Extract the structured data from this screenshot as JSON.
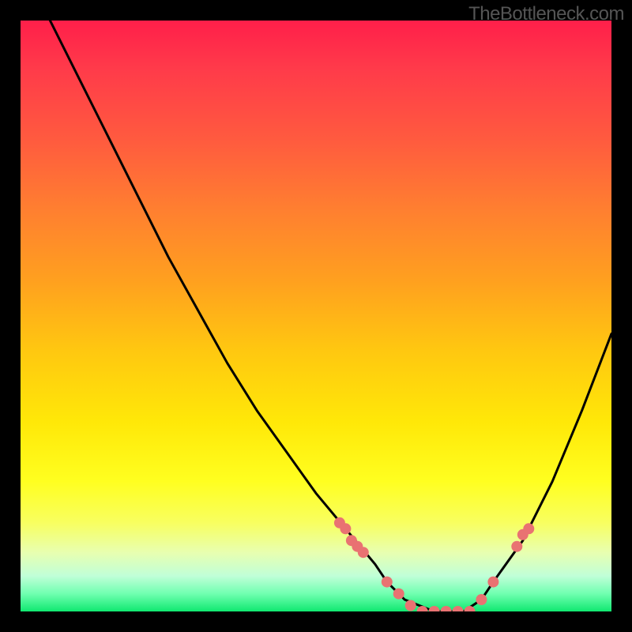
{
  "attribution": "TheBottleneck.com",
  "chart_data": {
    "type": "line",
    "title": "",
    "xlabel": "",
    "ylabel": "",
    "xlim": [
      0,
      100
    ],
    "ylim": [
      0,
      100
    ],
    "grid": false,
    "legend": false,
    "background_gradient": {
      "direction": "vertical",
      "stops": [
        {
          "pos": 0,
          "color": "#ff1f4a"
        },
        {
          "pos": 50,
          "color": "#ffd000"
        },
        {
          "pos": 85,
          "color": "#ffff50"
        },
        {
          "pos": 100,
          "color": "#10e870"
        }
      ],
      "semantic": "red=high_bottleneck, green=low_bottleneck"
    },
    "series": [
      {
        "name": "bottleneck-curve",
        "type": "line",
        "color": "#000000",
        "x": [
          5,
          10,
          15,
          20,
          25,
          30,
          35,
          40,
          45,
          50,
          55,
          60,
          62,
          65,
          70,
          73,
          75,
          78,
          80,
          85,
          90,
          95,
          100
        ],
        "y": [
          100,
          90,
          80,
          70,
          60,
          51,
          42,
          34,
          27,
          20,
          14,
          8,
          5,
          2,
          0,
          0,
          0,
          2,
          5,
          12,
          22,
          34,
          47
        ]
      },
      {
        "name": "marker-points",
        "type": "scatter",
        "color": "#e97272",
        "x": [
          54,
          55,
          56,
          57,
          58,
          62,
          64,
          66,
          68,
          70,
          72,
          74,
          76,
          78,
          80,
          84,
          85,
          86
        ],
        "y": [
          15,
          14,
          12,
          11,
          10,
          5,
          3,
          1,
          0,
          0,
          0,
          0,
          0,
          2,
          5,
          11,
          13,
          14
        ]
      }
    ]
  }
}
